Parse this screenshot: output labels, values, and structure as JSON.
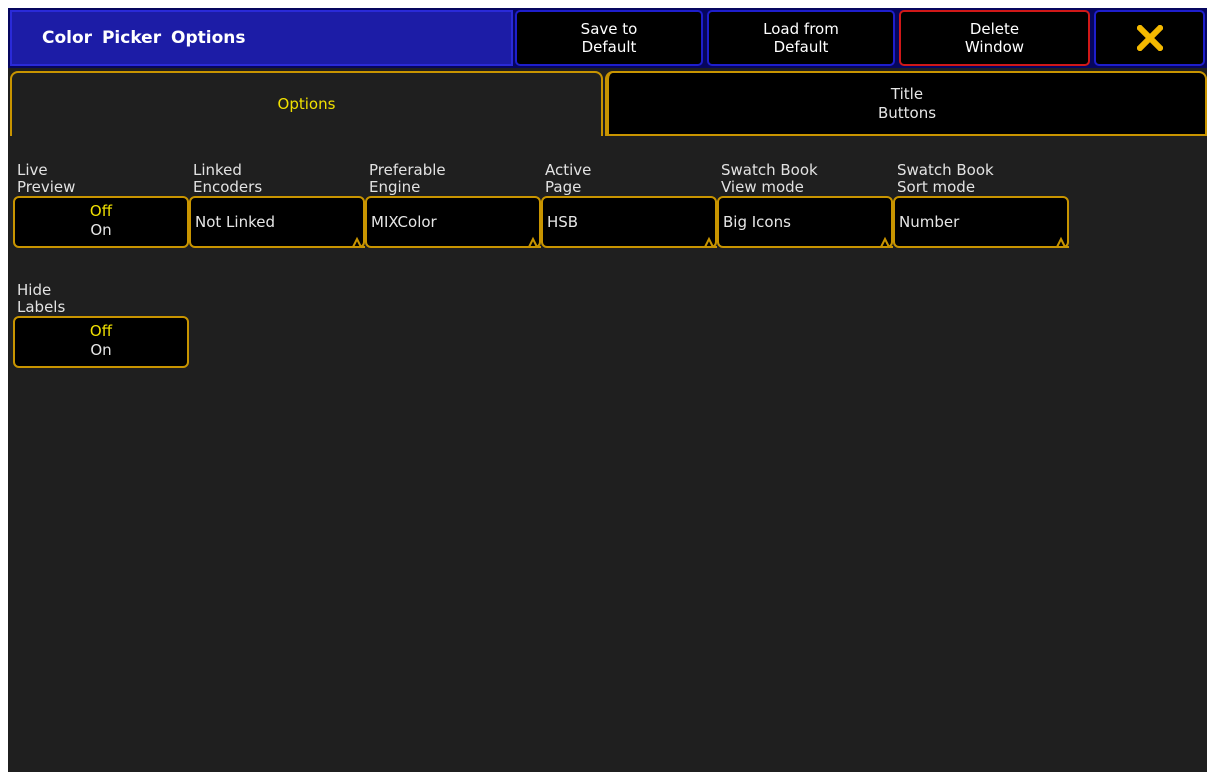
{
  "window": {
    "title": "Color Picker  Options"
  },
  "title_buttons": {
    "save": "Save to\nDefault",
    "load": "Load from\nDefault",
    "delete": "Delete\nWindow",
    "close_icon": "close-icon"
  },
  "tabs": [
    {
      "label": "Options",
      "active": true
    },
    {
      "label": "Title\nButtons",
      "active": false
    }
  ],
  "fields": [
    {
      "label": "Live\nPreview",
      "kind": "toggle",
      "options": [
        "Off",
        "On"
      ],
      "selected": "Off"
    },
    {
      "label": "Linked\nEncoders",
      "kind": "select",
      "value": "Not Linked"
    },
    {
      "label": "Preferable\nEngine",
      "kind": "select",
      "value": "MIXColor"
    },
    {
      "label": "Active\nPage",
      "kind": "select",
      "value": "HSB"
    },
    {
      "label": "Swatch Book\nView mode",
      "kind": "select",
      "value": "Big Icons"
    },
    {
      "label": "Swatch Book\nSort mode",
      "kind": "select",
      "value": "Number"
    },
    {
      "label": "Hide\nLabels",
      "kind": "toggle",
      "options": [
        "Off",
        "On"
      ],
      "selected": "Off"
    }
  ],
  "colors": {
    "title_bg": "#1c1ca6",
    "accent_border": "#c89400",
    "highlight_text": "#f0e000",
    "delete_border": "#d01818",
    "close_icon": "#f4b900"
  }
}
